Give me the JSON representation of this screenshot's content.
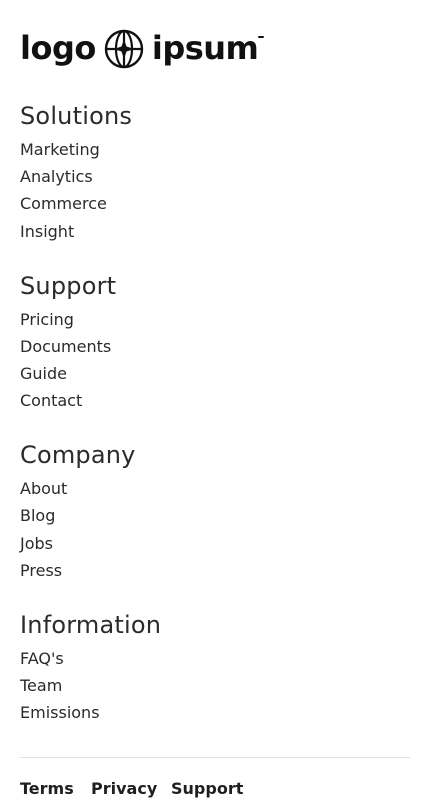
{
  "logo": {
    "left_text": "logo",
    "right_text": "ipsum",
    "icon": "globe-icon"
  },
  "sections": [
    {
      "title": "Solutions",
      "links": [
        "Marketing",
        "Analytics",
        "Commerce",
        "Insight"
      ]
    },
    {
      "title": "Support",
      "links": [
        "Pricing",
        "Documents",
        "Guide",
        "Contact"
      ]
    },
    {
      "title": "Company",
      "links": [
        "About",
        "Blog",
        "Jobs",
        "Press"
      ]
    },
    {
      "title": "Information",
      "links": [
        "FAQ's",
        "Team",
        "Emissions"
      ]
    }
  ],
  "bottom_links": [
    "Terms",
    "Privacy",
    "Support"
  ],
  "colors": {
    "text": "#2b2b2b",
    "divider": "#e2e2e2",
    "background": "#ffffff"
  }
}
